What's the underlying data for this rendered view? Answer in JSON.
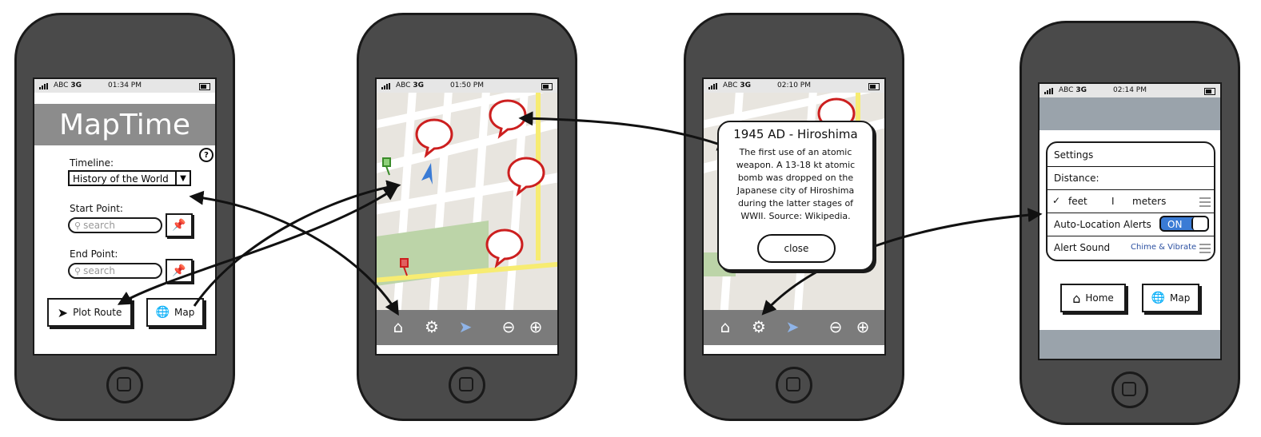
{
  "colors": {
    "phone_body": "#4a4a4a",
    "header_bar": "#8c8c8c",
    "toolbar": "#7b7b7b",
    "map_road_major": "#f7ec72",
    "map_park": "#bcd4a8",
    "pin_marker": "#cc1f1f",
    "accent_blue": "#3a7bd5",
    "toggle_on": "#3a7bd5"
  },
  "phone1": {
    "status": {
      "carrier": "ABC",
      "network": "3G",
      "time": "01:34 PM"
    },
    "title": "MapTime",
    "help_icon": "question-circle-icon",
    "timeline_label": "Timeline:",
    "timeline_value": "History of the World",
    "start_label": "Start Point:",
    "start_placeholder": "search",
    "end_label": "End Point:",
    "end_placeholder": "search",
    "plot_route_label": "Plot Route",
    "map_label": "Map"
  },
  "phone2": {
    "status": {
      "carrier": "ABC",
      "network": "3G",
      "time": "01:50 PM"
    },
    "toolbar_icons": [
      "home-icon",
      "gear-icon",
      "location-arrow-icon",
      "zoom-out-icon",
      "zoom-in-icon"
    ]
  },
  "phone3": {
    "status": {
      "carrier": "ABC",
      "network": "3G",
      "time": "02:10 PM"
    },
    "popup_title": "1945 AD - Hiroshima",
    "popup_text": "The first use of an atomic weapon. A 13-18 kt atomic bomb was dropped on the Japanese city of Hiroshima during the latter stages of WWII. Source: Wikipedia.",
    "close_label": "close"
  },
  "phone4": {
    "status": {
      "carrier": "ABC",
      "network": "3G",
      "time": "02:14 PM"
    },
    "settings_title": "Settings",
    "distance_label": "Distance:",
    "unit_feet": "feet",
    "unit_separator": "I",
    "unit_meters": "meters",
    "alerts_label": "Auto-Location Alerts",
    "alerts_toggle": "ON",
    "sound_label": "Alert Sound",
    "sound_value": "Chime & Vibrate",
    "home_label": "Home",
    "map_label": "Map"
  }
}
